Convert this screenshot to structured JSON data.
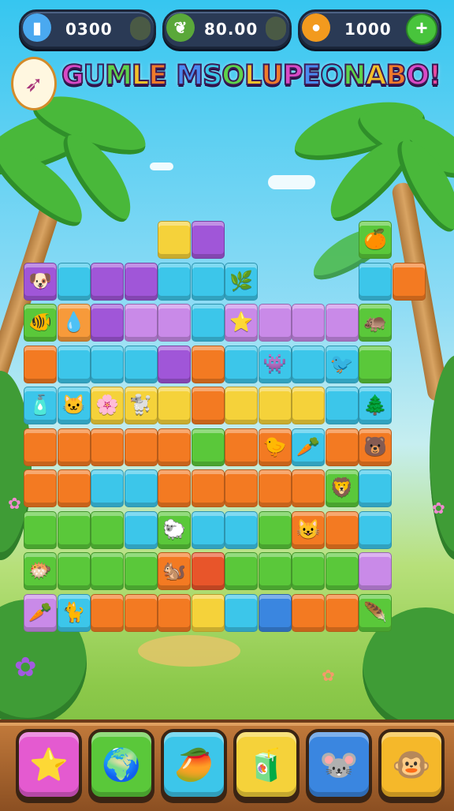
{
  "resources": [
    {
      "id": "cards",
      "value": "0300",
      "icon": "card-icon",
      "color": "#4aa9f0"
    },
    {
      "id": "leaves",
      "value": "80.00",
      "icon": "leaf-icon",
      "color": "#5aa83a"
    },
    {
      "id": "coins",
      "value": "1000",
      "icon": "coin-icon",
      "color": "#f29a1e"
    }
  ],
  "title": {
    "text": "GUMLE MSOLUPEONABO!",
    "badge_icon": "rocket-badge-icon",
    "letters_colors": [
      "#d84ac6",
      "#3ac8e8",
      "#5dd24a",
      "#f3c02a",
      "#f07a2a",
      "#e84aa0",
      "#4a8af0",
      "#3ac8e8",
      "#5dd24a",
      "#f3c02a",
      "#f07a2a",
      "#d84ac6",
      "#4a8af0",
      "#3ac8e8",
      "#5dd24a",
      "#f3c02a",
      "#f07a2a",
      "#d84ac6",
      "#e84aa0"
    ]
  },
  "tile_colors": {
    "o": "#f37a22",
    "g": "#5ac83a",
    "c": "#3cc6ea",
    "p": "#a056d8",
    "l": "#c98ae8",
    "y": "#f5d23a",
    "b": "#3a86e0",
    "r": "#e8552a",
    "k": "#f79a3a",
    "m": "#7cd63a"
  },
  "board_rows": [
    "....yp....g",
    "pcppccc...co",
    "gkpllcllllg",
    "occcpoccccg",
    "ccyyyoyyycc",
    "ooooogoocoo",
    "ooccooooogc",
    "gggcgccgooc",
    "ggggorggggl",
    "lcoooycboog"
  ],
  "tiles": [
    {
      "r": 0,
      "c": 1,
      "color": "y",
      "icon": "fruit-icon",
      "glyph": "🍐"
    },
    {
      "r": 0,
      "c": 2,
      "color": "p",
      "icon": "bunny-icon",
      "glyph": "🐰"
    },
    {
      "r": 0,
      "c": 10,
      "color": "g",
      "icon": "fruit-icon",
      "glyph": "🍊"
    },
    {
      "r": 1,
      "c": 0,
      "color": "p",
      "icon": "dog-icon",
      "glyph": "🐶"
    },
    {
      "r": 1,
      "c": 6,
      "color": "c",
      "icon": "leaf-icon",
      "glyph": "🌿"
    },
    {
      "r": 2,
      "c": 0,
      "color": "g",
      "icon": "fish-icon",
      "glyph": "🐠"
    },
    {
      "r": 2,
      "c": 1,
      "color": "k",
      "icon": "drop-icon",
      "glyph": "💧"
    },
    {
      "r": 2,
      "c": 6,
      "color": "l",
      "icon": "star-icon",
      "glyph": "⭐"
    },
    {
      "r": 2,
      "c": 10,
      "color": "l",
      "icon": "hippo-icon",
      "glyph": "🦛"
    },
    {
      "r": 2,
      "c": 11,
      "color": "o",
      "icon": "fox-icon",
      "glyph": "🦊"
    },
    {
      "r": 3,
      "c": 7,
      "color": "c",
      "icon": "monster-icon",
      "glyph": "👾"
    },
    {
      "r": 3,
      "c": 9,
      "color": "c",
      "icon": "bird-icon",
      "glyph": "🐦"
    },
    {
      "r": 3,
      "c": 11,
      "color": "g",
      "icon": "frog-icon",
      "glyph": "🐸"
    },
    {
      "r": 4,
      "c": 0,
      "color": "y",
      "icon": "bottle-icon",
      "glyph": "🧴"
    },
    {
      "r": 4,
      "c": 1,
      "color": "y",
      "icon": "cat-icon",
      "glyph": "🐱"
    },
    {
      "r": 4,
      "c": 2,
      "color": "y",
      "icon": "flower-icon",
      "glyph": "🌸"
    },
    {
      "r": 4,
      "c": 3,
      "color": "y",
      "icon": "poodle-icon",
      "glyph": "🐩"
    },
    {
      "r": 4,
      "c": 10,
      "color": "c",
      "icon": "tree-icon",
      "glyph": "🌲"
    },
    {
      "r": 4,
      "c": 11,
      "color": "c",
      "icon": "deer-icon",
      "glyph": "🦌"
    },
    {
      "r": 5,
      "c": 7,
      "color": "c",
      "icon": "bird-icon",
      "glyph": "🐤"
    },
    {
      "r": 5,
      "c": 8,
      "color": "o",
      "icon": "carrot-icon",
      "glyph": "🥕"
    },
    {
      "r": 5,
      "c": 10,
      "color": "o",
      "icon": "bear-icon",
      "glyph": "🐻"
    },
    {
      "r": 5,
      "c": 11,
      "color": "o",
      "icon": "hamster-icon",
      "glyph": "🐹"
    },
    {
      "r": 6,
      "c": 9,
      "color": "c",
      "icon": "lion-icon",
      "glyph": "🦁"
    },
    {
      "r": 6,
      "c": 11,
      "color": "g",
      "icon": "feather-icon",
      "glyph": "🪶"
    },
    {
      "r": 7,
      "c": 4,
      "color": "g",
      "icon": "sheep-icon",
      "glyph": "🐑"
    },
    {
      "r": 7,
      "c": 8,
      "color": "g",
      "icon": "cat-icon",
      "glyph": "😺"
    },
    {
      "r": 7,
      "c": 11,
      "color": "o",
      "icon": "pear-icon",
      "glyph": "🍐"
    },
    {
      "r": 8,
      "c": 0,
      "color": "g",
      "icon": "fish-icon",
      "glyph": "🐡"
    },
    {
      "r": 8,
      "c": 4,
      "color": "o",
      "icon": "squirrel-icon",
      "glyph": "🐿️"
    },
    {
      "r": 8,
      "c": 11,
      "color": "l",
      "icon": "shell-icon",
      "glyph": "🐚"
    },
    {
      "r": 9,
      "c": 0,
      "color": "l",
      "icon": "carrot-icon",
      "glyph": "🥕"
    },
    {
      "r": 9,
      "c": 1,
      "color": "c",
      "icon": "cat-icon",
      "glyph": "🐈"
    },
    {
      "r": 9,
      "c": 10,
      "color": "c",
      "icon": "feather-icon",
      "glyph": "🪶"
    },
    {
      "r": 9,
      "c": 11,
      "color": "g",
      "icon": "cheese-icon",
      "glyph": "🧀"
    }
  ],
  "boosters": [
    {
      "name": "star-booster",
      "glyph": "⭐",
      "bg": "#e45ad0",
      "icon": "star-icon"
    },
    {
      "name": "globe-booster",
      "glyph": "🌍",
      "bg": "#5ac83a",
      "icon": "globe-icon"
    },
    {
      "name": "fruit-booster",
      "glyph": "🥭",
      "bg": "#3cc6ea",
      "icon": "mango-icon"
    },
    {
      "name": "box-booster",
      "glyph": "🧃",
      "bg": "#f5d23a",
      "icon": "box-icon"
    },
    {
      "name": "mouse-booster",
      "glyph": "🐭",
      "bg": "#3a86e0",
      "icon": "mouse-icon"
    },
    {
      "name": "monkey-booster",
      "glyph": "🐵",
      "bg": "#f5b82a",
      "icon": "monkey-icon"
    }
  ]
}
